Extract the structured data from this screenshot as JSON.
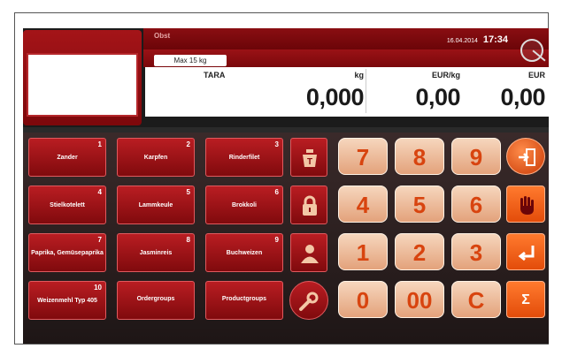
{
  "header": {
    "product_name": "Obst",
    "date": "16.04.2014",
    "time": "17:34",
    "max_label": "Max 15 kg"
  },
  "scale": {
    "tara_label": "TARA",
    "weight": {
      "unit": "kg",
      "value": "0,000"
    },
    "unit_price": {
      "unit": "EUR/kg",
      "value": "0,00"
    },
    "total_price": {
      "unit": "EUR",
      "value": "0,00"
    }
  },
  "products": [
    {
      "num": "1",
      "label": "Zander"
    },
    {
      "num": "2",
      "label": "Karpfen"
    },
    {
      "num": "3",
      "label": "Rinderfilet"
    },
    {
      "num": "4",
      "label": "Stielkotelett"
    },
    {
      "num": "5",
      "label": "Lammkeule"
    },
    {
      "num": "6",
      "label": "Brokkoli"
    },
    {
      "num": "7",
      "label": "Paprika, Gemüsepaprika"
    },
    {
      "num": "8",
      "label": "Jasminreis"
    },
    {
      "num": "9",
      "label": "Buchweizen"
    },
    {
      "num": "10",
      "label": "Weizenmehl Typ 405"
    },
    {
      "num": "",
      "label": "Ordergroups"
    },
    {
      "num": "",
      "label": "Productgroups"
    }
  ],
  "keypad": [
    "7",
    "8",
    "9",
    "4",
    "5",
    "6",
    "1",
    "2",
    "3",
    "0",
    "00",
    "C"
  ],
  "actions": {
    "sum_label": "Σ"
  },
  "icons": {
    "tara": "tara-weight-icon",
    "lock": "padlock-icon",
    "user": "user-icon",
    "wrench": "wrench-icon",
    "exit": "exit-door-icon",
    "stop": "hand-stop-icon",
    "enter": "enter-arrow-icon",
    "settings": "settings-circle-icon"
  },
  "colors": {
    "accent_red": "#b91d22",
    "keypad_text": "#d8440f",
    "action_orange": "#ff7a2e"
  }
}
